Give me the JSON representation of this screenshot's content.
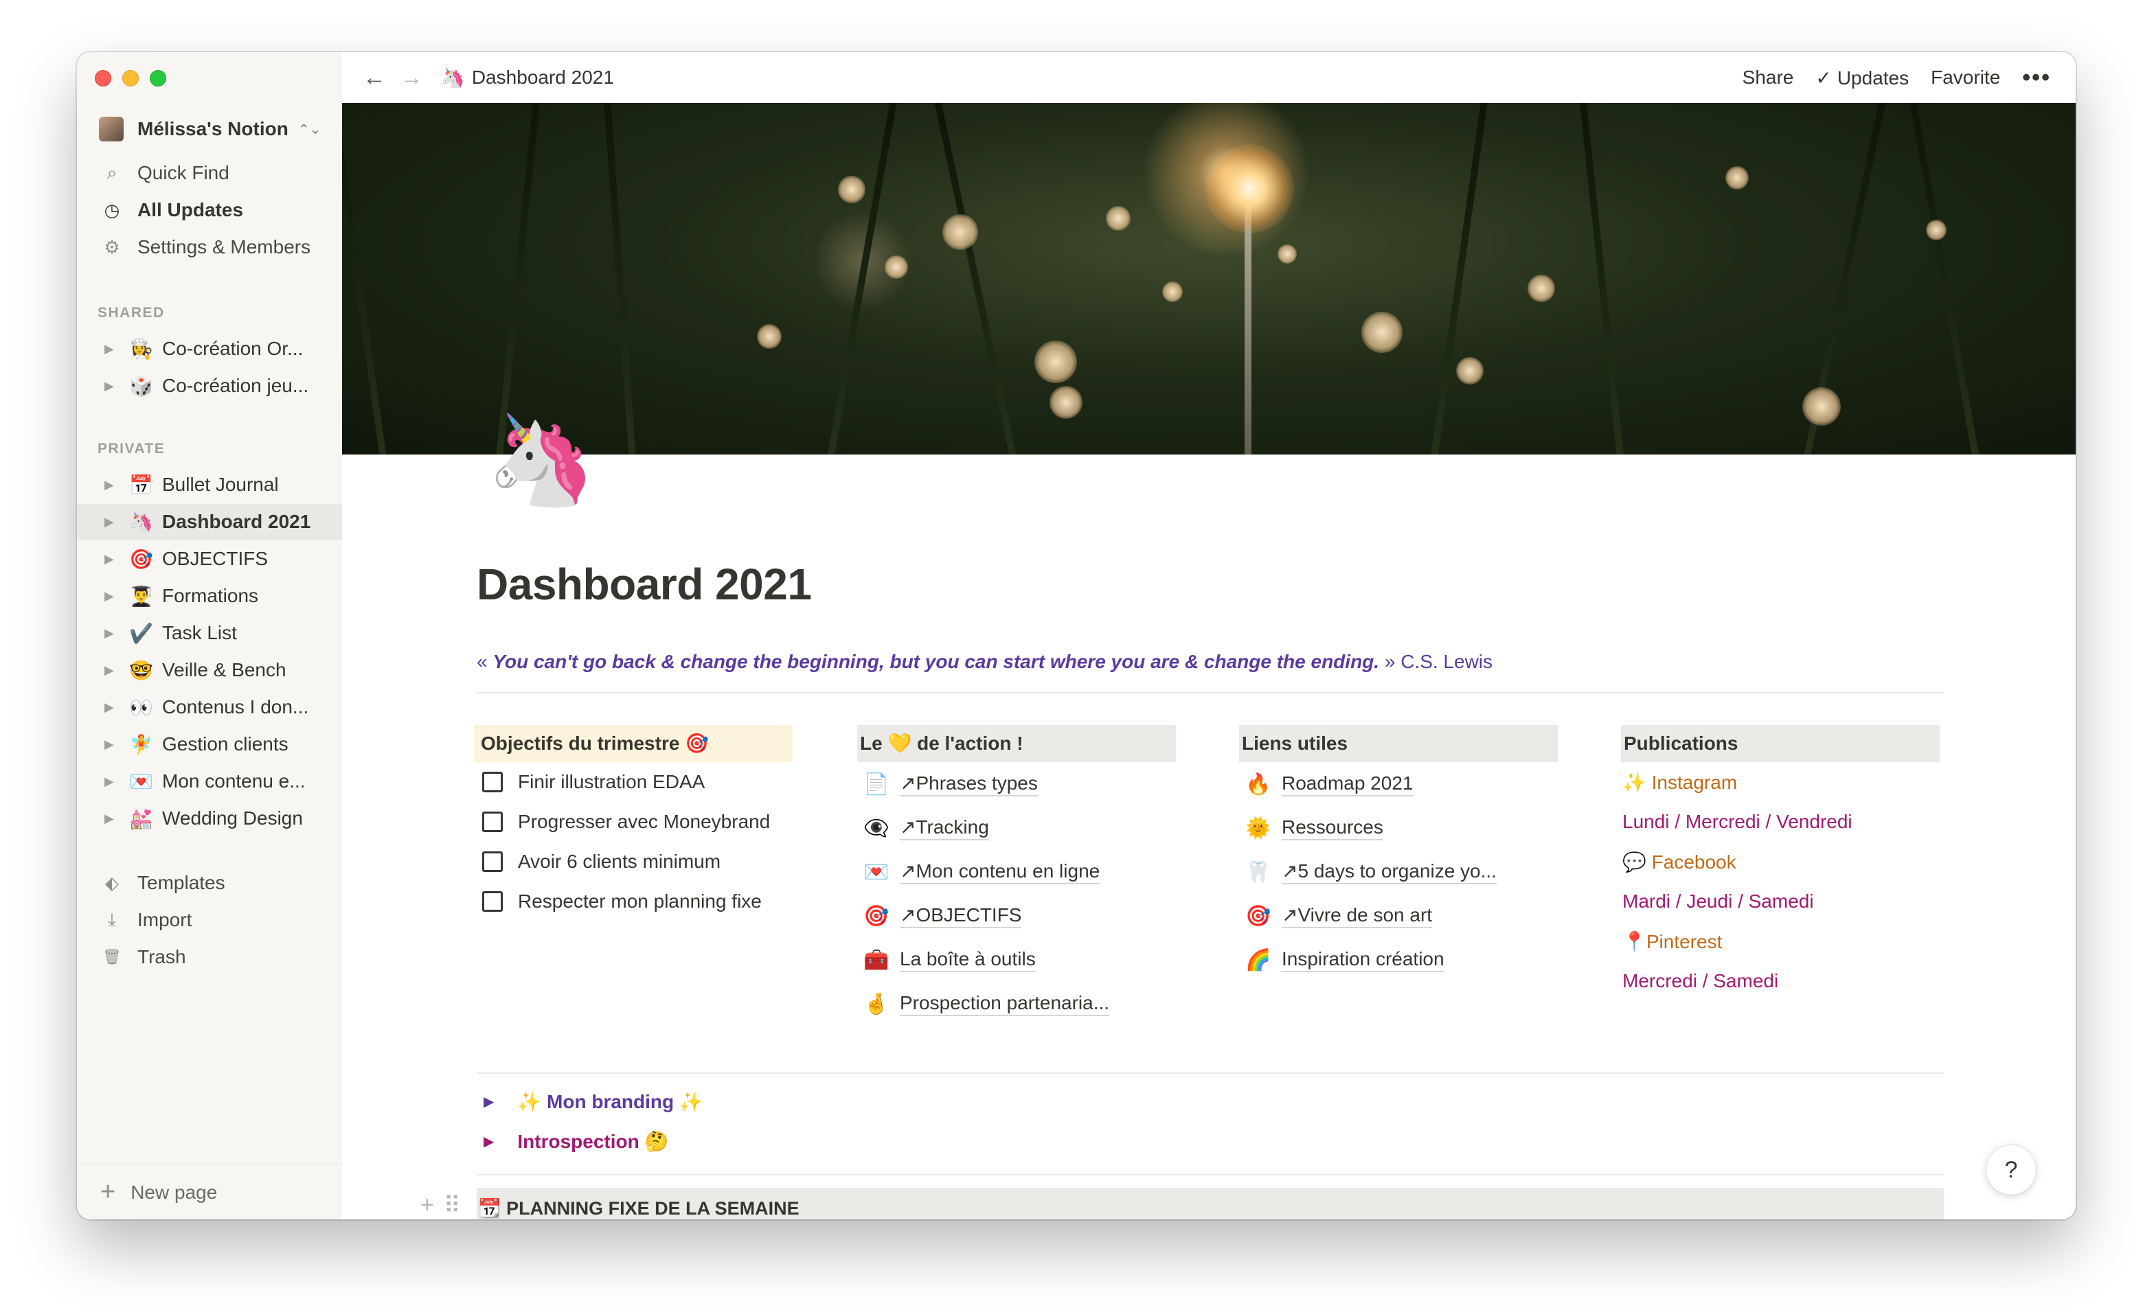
{
  "workspace": {
    "name": "Mélissa's Notion"
  },
  "sidebar": {
    "utilities": [
      {
        "label": "Quick Find",
        "icon": "search-icon",
        "glyph": "⌕"
      },
      {
        "label": "All Updates",
        "icon": "clock-icon",
        "glyph": "◷"
      },
      {
        "label": "Settings & Members",
        "icon": "gear-icon",
        "glyph": "⚙"
      }
    ],
    "shared_label": "SHARED",
    "shared": [
      {
        "emoji": "👩‍🍳",
        "label": "Co-création Or..."
      },
      {
        "emoji": "🎲",
        "label": "Co-création jeu..."
      }
    ],
    "private_label": "PRIVATE",
    "private": [
      {
        "emoji": "📅",
        "label": "Bullet Journal"
      },
      {
        "emoji": "🦄",
        "label": "Dashboard 2021"
      },
      {
        "emoji": "🎯",
        "label": "OBJECTIFS"
      },
      {
        "emoji": "👨‍🎓",
        "label": "Formations"
      },
      {
        "emoji": "✔️",
        "label": "Task List"
      },
      {
        "emoji": "🤓",
        "label": "Veille & Bench"
      },
      {
        "emoji": "👀",
        "label": "Contenus I don..."
      },
      {
        "emoji": "🧚",
        "label": "Gestion clients"
      },
      {
        "emoji": "💌",
        "label": "Mon contenu e..."
      },
      {
        "emoji": "💒",
        "label": "Wedding Design"
      }
    ],
    "tools": [
      {
        "label": "Templates",
        "icon": "templates-icon",
        "glyph": "⬖"
      },
      {
        "label": "Import",
        "icon": "import-icon",
        "glyph": "⤓"
      },
      {
        "label": "Trash",
        "icon": "trash-icon",
        "glyph": "🗑"
      }
    ],
    "new_page": "New page"
  },
  "topbar": {
    "breadcrumb_emoji": "🦄",
    "breadcrumb": "Dashboard 2021",
    "share": "Share",
    "updates": "Updates",
    "favorite": "Favorite",
    "more": "•••"
  },
  "page": {
    "icon": "🦄",
    "title": "Dashboard 2021",
    "quote_open": "« ",
    "quote_text": "You can't go back & change the beginning, but you can start where you are & change the ending.",
    "quote_close": " » C.S. Lewis"
  },
  "columns": {
    "objectives": {
      "title": "Objectifs du trimestre 🎯",
      "items": [
        "Finir illustration EDAA",
        "Progresser avec Moneybrand",
        "Avoir 6 clients minimum",
        "Respecter mon planning fixe"
      ]
    },
    "action": {
      "title": "Le 💛 de l'action !",
      "items": [
        {
          "emoji": "📄",
          "label": "↗Phrases types"
        },
        {
          "emoji": "👁‍🗨",
          "label": "↗Tracking"
        },
        {
          "emoji": "💌",
          "label": "↗Mon contenu en ligne"
        },
        {
          "emoji": "🎯",
          "label": "↗OBJECTIFS"
        },
        {
          "emoji": "🧰",
          "label": "La boîte à outils"
        },
        {
          "emoji": "🤞",
          "label": "Prospection partenaria..."
        }
      ]
    },
    "links": {
      "title": "Liens utiles",
      "items": [
        {
          "emoji": "🔥",
          "label": "Roadmap 2021"
        },
        {
          "emoji": "🌞",
          "label": "Ressources"
        },
        {
          "emoji": "🦷",
          "label": "↗5 days to organize yo..."
        },
        {
          "emoji": "🎯",
          "label": "↗Vivre de son art"
        },
        {
          "emoji": "🌈",
          "label": "Inspiration création"
        }
      ]
    },
    "publications": {
      "title": "Publications",
      "items": [
        {
          "label": "✨ Instagram",
          "color": "#c36a17"
        },
        {
          "label": "Lundi / Mercredi / Vendredi",
          "color": "#a01a73"
        },
        {
          "label": "💬 Facebook",
          "color": "#c36a17"
        },
        {
          "label": "Mardi / Jeudi / Samedi",
          "color": "#a01a73"
        },
        {
          "label": "📍Pinterest",
          "color": "#c36a17"
        },
        {
          "label": "Mercredi / Samedi",
          "color": "#a01a73"
        }
      ]
    }
  },
  "toggles": [
    {
      "label": "✨ Mon branding ✨"
    },
    {
      "label": "Introspection 🤔"
    }
  ],
  "bottom_block": "📆 PLANNING FIXE DE LA SEMAINE",
  "help": "?"
}
